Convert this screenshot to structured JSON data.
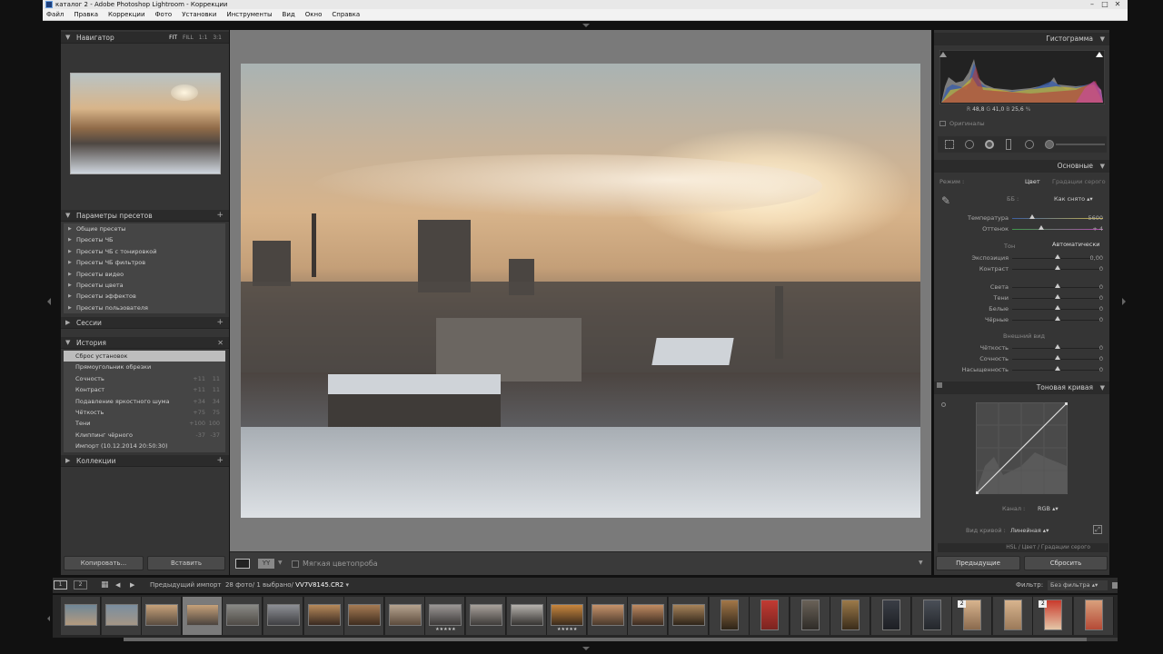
{
  "window": {
    "title": "каталог 2 - Adobe Photoshop Lightroom - Коррекции"
  },
  "menu": [
    "Файл",
    "Правка",
    "Коррекции",
    "Фото",
    "Установки",
    "Инструменты",
    "Вид",
    "Окно",
    "Справка"
  ],
  "navigator": {
    "title": "Навигатор",
    "options": [
      "FIT",
      "FILL",
      "1:1",
      "3:1"
    ]
  },
  "presets": {
    "title": "Параметры пресетов",
    "items": [
      "Общие пресеты",
      "Пресеты ЧБ",
      "Пресеты ЧБ с тонировкой",
      "Пресеты ЧБ фильтров",
      "Пресеты видео",
      "Пресеты цвета",
      "Пресеты эффектов",
      "Пресеты пользователя"
    ]
  },
  "sessions": {
    "title": "Сессии"
  },
  "history": {
    "title": "История",
    "items": [
      {
        "label": "Сброс установок",
        "v1": "",
        "v2": ""
      },
      {
        "label": "Прямоугольник обрезки",
        "v1": "",
        "v2": ""
      },
      {
        "label": "Сочность",
        "v1": "+11",
        "v2": "11"
      },
      {
        "label": "Контраст",
        "v1": "+11",
        "v2": "11"
      },
      {
        "label": "Подавление яркостного шума",
        "v1": "+34",
        "v2": "34"
      },
      {
        "label": "Чёткость",
        "v1": "+75",
        "v2": "75"
      },
      {
        "label": "Тени",
        "v1": "+100",
        "v2": "100"
      },
      {
        "label": "Клиппинг чёрного",
        "v1": "-37",
        "v2": "-37"
      },
      {
        "label": "Импорт (10.12.2014 20:50:30)",
        "v1": "",
        "v2": ""
      }
    ]
  },
  "collections": {
    "title": "Коллекции"
  },
  "left_buttons": {
    "copy": "Копировать...",
    "paste": "Вставить"
  },
  "toolbar": {
    "soft_proof": "Мягкая цветопроба"
  },
  "histogram": {
    "title": "Гистограмма",
    "r_label": "R",
    "r": "48,8",
    "g_label": "G",
    "g": "41,0",
    "b_label": "B",
    "b": "25,6",
    "pct": "%",
    "originals": "Оригиналы"
  },
  "basic": {
    "title": "Основные",
    "mode_label": "Режим :",
    "mode_color": "Цвет",
    "mode_gray": "Градации серого",
    "wb_label": "ББ :",
    "wb_value": "Как снято",
    "temp_label": "Температура",
    "temp_value": "5600",
    "tint_label": "Оттенок",
    "tint_value": "+ 4",
    "tone_label": "Тон",
    "auto": "Автоматически",
    "sliders": [
      {
        "label": "Экспозиция",
        "value": "0,00",
        "pos": 0.5
      },
      {
        "label": "Контраст",
        "value": "0",
        "pos": 0.5
      },
      {
        "label": "Света",
        "value": "0",
        "pos": 0.5
      },
      {
        "label": "Тени",
        "value": "0",
        "pos": 0.5
      },
      {
        "label": "Белые",
        "value": "0",
        "pos": 0.5
      },
      {
        "label": "Чёрные",
        "value": "0",
        "pos": 0.5
      }
    ],
    "presence_label": "Внешний вид",
    "presence": [
      {
        "label": "Чёткость",
        "value": "0",
        "pos": 0.5
      },
      {
        "label": "Сочность",
        "value": "0",
        "pos": 0.5
      },
      {
        "label": "Насыщенность",
        "value": "0",
        "pos": 0.5
      }
    ]
  },
  "tone_curve": {
    "title": "Тоновая кривая",
    "channel_label": "Канал :",
    "channel": "RGB",
    "curve_label": "Вид кривой :",
    "curve": "Линейная"
  },
  "hsl": {
    "title": "HSL / Цвет / Градации серого"
  },
  "right_buttons": {
    "previous": "Предыдущие",
    "reset": "Сбросить"
  },
  "filmstrip_bar": {
    "pages": [
      "1",
      "2"
    ],
    "source": "Предыдущий импорт",
    "count": "28 фото/",
    "selected": "1 выбрано/",
    "filename": "VV7V8145.CR2",
    "filter_label": "Фильтр:",
    "filter_value": "Без фильтра"
  },
  "filmstrip": [
    {
      "c1": "#6f8798",
      "c2": "#b49a7e",
      "stars": "",
      "badge": ""
    },
    {
      "c1": "#7a8ea0",
      "c2": "#a59686",
      "stars": "",
      "badge": ""
    },
    {
      "c1": "#c7a27a",
      "c2": "#5a4c40",
      "stars": "",
      "badge": ""
    },
    {
      "c1": "#c7a27a",
      "c2": "#4c443e",
      "stars": "",
      "badge": "",
      "sel": true
    },
    {
      "c1": "#8a8a86",
      "c2": "#4e4a45",
      "stars": "",
      "badge": ""
    },
    {
      "c1": "#8e9096",
      "c2": "#3f3f42",
      "stars": "",
      "badge": ""
    },
    {
      "c1": "#b78a5b",
      "c2": "#3a2a20",
      "stars": "",
      "badge": ""
    },
    {
      "c1": "#a77c54",
      "c2": "#3f2c1e",
      "stars": "",
      "badge": ""
    },
    {
      "c1": "#b7a490",
      "c2": "#5d4c3d",
      "stars": "",
      "badge": ""
    },
    {
      "c1": "#9c9896",
      "c2": "#3d3a39",
      "stars": "★★★★★",
      "badge": ""
    },
    {
      "c1": "#a9a29c",
      "c2": "#3f3c3a",
      "stars": "",
      "badge": ""
    },
    {
      "c1": "#b7b3ae",
      "c2": "#353331",
      "stars": "",
      "badge": ""
    },
    {
      "c1": "#c9873e",
      "c2": "#3b2b1c",
      "stars": "★★★★★",
      "badge": ""
    },
    {
      "c1": "#c7936b",
      "c2": "#4b3a2c",
      "stars": "",
      "badge": ""
    },
    {
      "c1": "#c18c62",
      "c2": "#3c2c20",
      "stars": "",
      "badge": ""
    },
    {
      "c1": "#a8845a",
      "c2": "#2e2418",
      "stars": "",
      "badge": ""
    },
    {
      "c1": "#a37748",
      "c2": "#2d2418",
      "stars": "",
      "badge": ""
    },
    {
      "c1": "#c23b33",
      "c2": "#7b2420",
      "stars": "",
      "badge": ""
    },
    {
      "c1": "#6a6258",
      "c2": "#2f2c28",
      "stars": "",
      "badge": ""
    },
    {
      "c1": "#9c7a4a",
      "c2": "#3a2c1a",
      "stars": "",
      "badge": ""
    },
    {
      "c1": "#3a3e46",
      "c2": "#1d1f24",
      "stars": "",
      "badge": ""
    },
    {
      "c1": "#4a4f57",
      "c2": "#24272c",
      "stars": "",
      "badge": ""
    },
    {
      "c1": "#d8b48e",
      "c2": "#8a6a4e",
      "stars": "",
      "badge": "2"
    },
    {
      "c1": "#d8b48e",
      "c2": "#9b7a5a",
      "stars": "",
      "badge": ""
    },
    {
      "c1": "#c93a2c",
      "c2": "#e4c6a8",
      "stars": "",
      "badge": "2"
    },
    {
      "c1": "#d9a07c",
      "c2": "#b54a36",
      "stars": "",
      "badge": ""
    }
  ]
}
